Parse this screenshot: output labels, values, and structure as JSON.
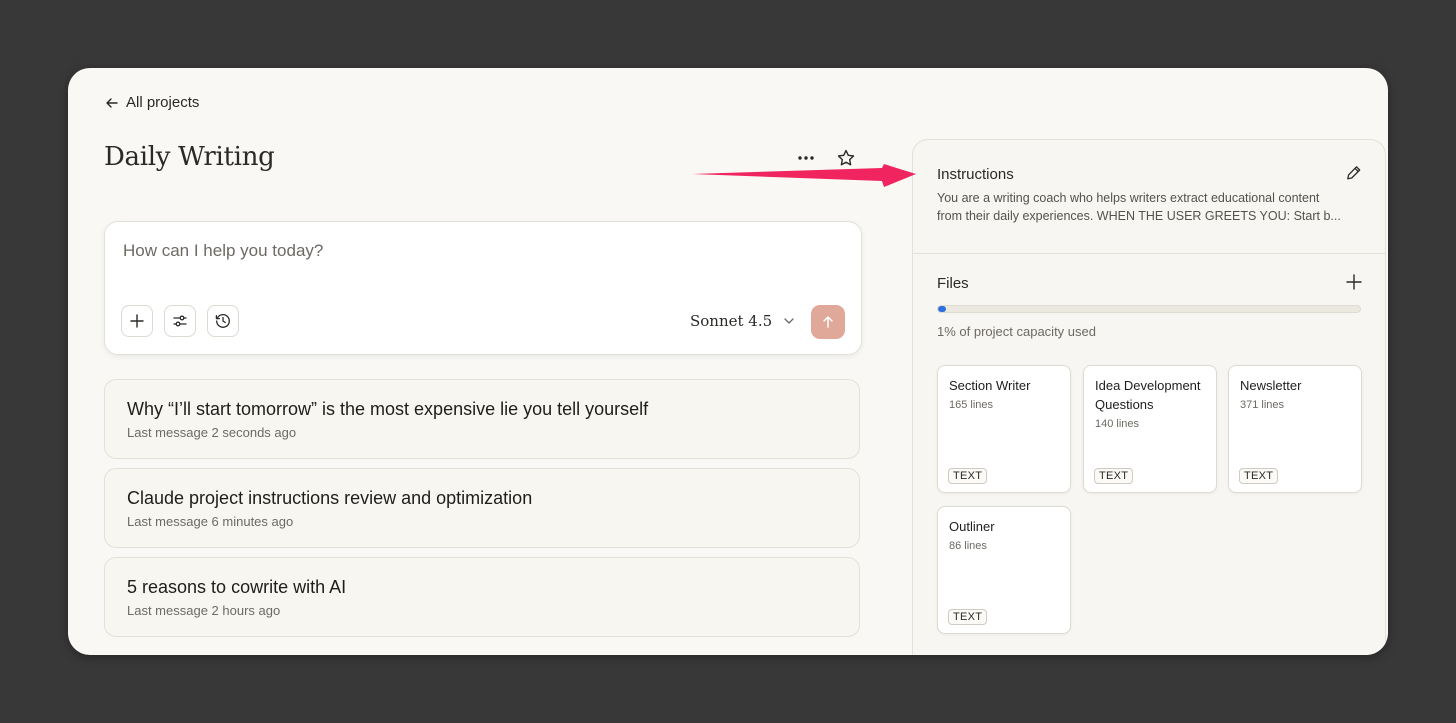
{
  "nav": {
    "back_label": "All projects"
  },
  "project": {
    "title": "Daily Writing"
  },
  "composer": {
    "placeholder": "How can I help you today?",
    "model_label": "Sonnet 4.5"
  },
  "chats": [
    {
      "title": "Why “I’ll start tomorrow” is the most expensive lie you tell yourself",
      "meta": "Last message 2 seconds ago"
    },
    {
      "title": "Claude project instructions review and optimization",
      "meta": "Last message 6 minutes ago"
    },
    {
      "title": "5 reasons to cowrite with AI",
      "meta": "Last message 2 hours ago"
    }
  ],
  "instructions": {
    "label": "Instructions",
    "line1": "You are a writing coach who helps writers extract educational content",
    "line2": "from their daily experiences. WHEN THE USER GREETS YOU: Start b..."
  },
  "files": {
    "label": "Files",
    "capacity_text": "1% of project capacity used",
    "capacity_fraction": 0.01,
    "items": [
      {
        "name": "Section Writer",
        "lines": "165 lines",
        "type": "TEXT"
      },
      {
        "name": "Idea Development Questions",
        "lines": "140 lines",
        "type": "TEXT"
      },
      {
        "name": "Newsletter",
        "lines": "371 lines",
        "type": "TEXT"
      },
      {
        "name": "Outliner",
        "lines": "86 lines",
        "type": "TEXT"
      }
    ]
  },
  "colors": {
    "accent_arrow": "#f0245f",
    "send_button": "#e0a898",
    "capacity_fill": "#2e6fe0"
  },
  "icons": {
    "back": "arrow-left-icon",
    "more": "ellipsis-icon",
    "star": "star-icon",
    "add": "plus-icon",
    "settings": "sliders-icon",
    "history": "clock-icon",
    "dropdown": "chevron-down-icon",
    "send": "arrow-up-icon",
    "edit": "pencil-icon"
  }
}
